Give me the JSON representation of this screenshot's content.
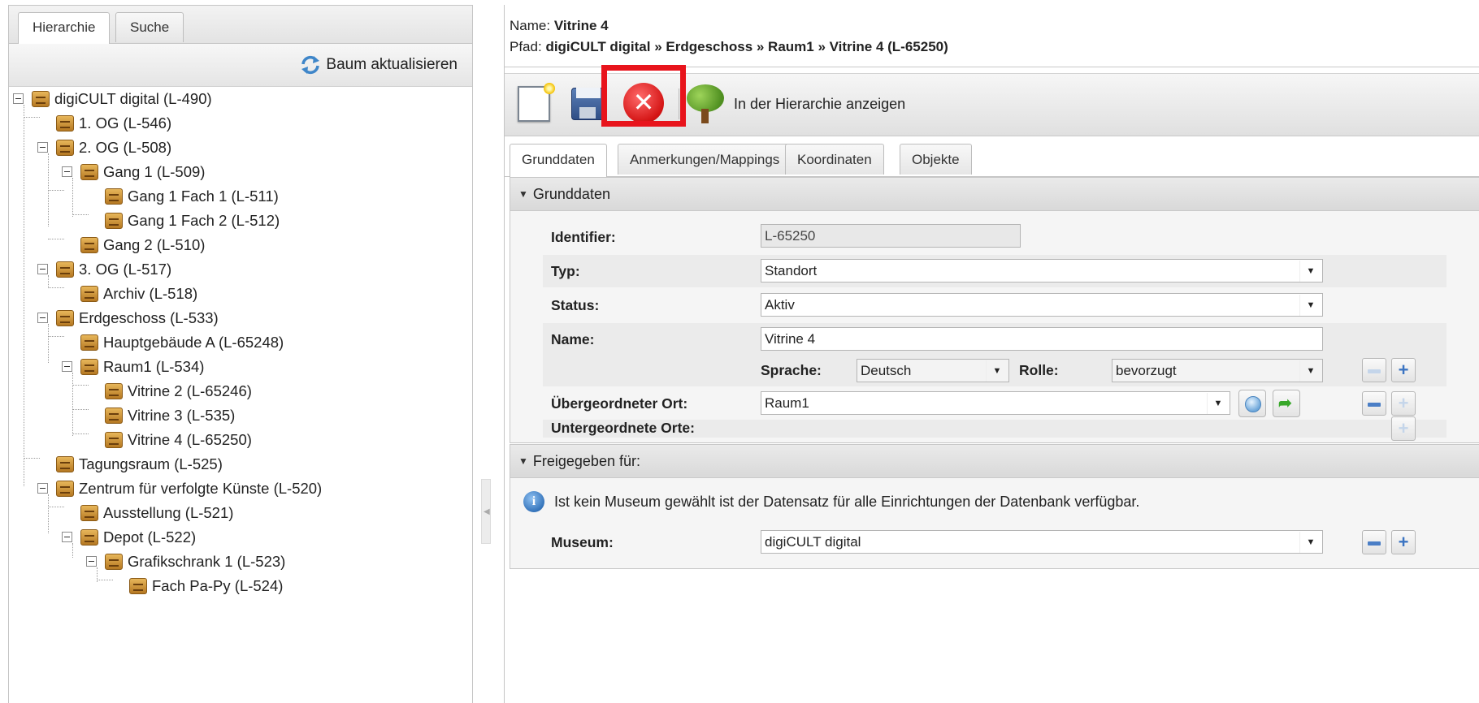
{
  "left_tabs": [
    "Hierarchie",
    "Suche"
  ],
  "reload_label": "Baum aktualisieren",
  "tree": [
    {
      "label": "digiCULT digital (L-490)"
    },
    {
      "label": "1. OG (L-546)"
    },
    {
      "label": "2. OG (L-508)"
    },
    {
      "label": "Gang 1 (L-509)"
    },
    {
      "label": "Gang 1 Fach 1 (L-511)"
    },
    {
      "label": "Gang 1 Fach 2 (L-512)"
    },
    {
      "label": "Gang 2 (L-510)"
    },
    {
      "label": "3. OG (L-517)"
    },
    {
      "label": "Archiv (L-518)"
    },
    {
      "label": "Erdgeschoss (L-533)"
    },
    {
      "label": "Hauptgebäude A (L-65248)"
    },
    {
      "label": "Raum1 (L-534)"
    },
    {
      "label": "Vitrine 2 (L-65246)"
    },
    {
      "label": "Vitrine 3 (L-535)"
    },
    {
      "label": "Vitrine 4 (L-65250)"
    },
    {
      "label": "Tagungsraum (L-525)"
    },
    {
      "label": "Zentrum für verfolgte Künste (L-520)"
    },
    {
      "label": "Ausstellung (L-521)"
    },
    {
      "label": "Depot (L-522)"
    },
    {
      "label": "Grafikschrank 1 (L-523)"
    },
    {
      "label": "Fach Pa-Py (L-524)"
    }
  ],
  "header": {
    "name_label": "Name:",
    "name_value": "Vitrine 4",
    "path_label": "Pfad:",
    "path_value": "digiCULT digital » Erdgeschoss » Raum1 » Vitrine 4 (L-65250)"
  },
  "toolbar": {
    "show_in_hierarchy": "In der Hierarchie anzeigen"
  },
  "tabs": [
    "Grunddaten",
    "Anmerkungen/Mappings",
    "Koordinaten",
    "Objekte"
  ],
  "grunddaten": {
    "title": "Grunddaten",
    "identifier_label": "Identifier:",
    "identifier_value": "L-65250",
    "typ_label": "Typ:",
    "typ_value": "Standort",
    "status_label": "Status:",
    "status_value": "Aktiv",
    "name_label": "Name:",
    "name_value": "Vitrine 4",
    "sprache_label": "Sprache:",
    "sprache_value": "Deutsch",
    "rolle_label": "Rolle:",
    "rolle_value": "bevorzugt",
    "parent_label": "Übergeordneter Ort:",
    "parent_value": "Raum1",
    "children_label": "Untergeordnete Orte:"
  },
  "freigabe": {
    "title": "Freigegeben für:",
    "info": "Ist kein Museum gewählt ist der Datensatz für alle Einrichtungen der Datenbank verfügbar.",
    "museum_label": "Museum:",
    "museum_value": "digiCULT digital"
  }
}
